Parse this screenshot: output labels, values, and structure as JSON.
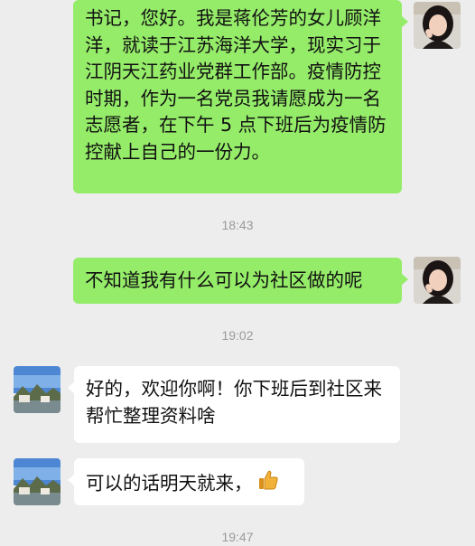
{
  "messages": [
    {
      "side": "right",
      "text": "书记，您好。我是蒋伦芳的女儿顾洋洋，就读于江苏海洋大学，现实习于江阴天江药业党群工作部。疫情防控时期，作为一名党员我请愿成为一名志愿者，在下午 5 点下班后为疫情防控献上自己的一份力。"
    },
    {
      "time": "18:43"
    },
    {
      "side": "right",
      "text": "不知道我有什么可以为社区做的呢"
    },
    {
      "time": "19:02"
    },
    {
      "side": "left",
      "text": "好的，欢迎你啊！你下班后到社区来帮忙整理资料啥"
    },
    {
      "side": "left",
      "text": "可以的话明天就来，",
      "emoji": "thumbs-up-icon"
    },
    {
      "time": "19:47"
    }
  ],
  "colors": {
    "background": "#ededed",
    "sent_bubble": "#95ec69",
    "received_bubble": "#ffffff",
    "timestamp": "#9a9a9a"
  }
}
